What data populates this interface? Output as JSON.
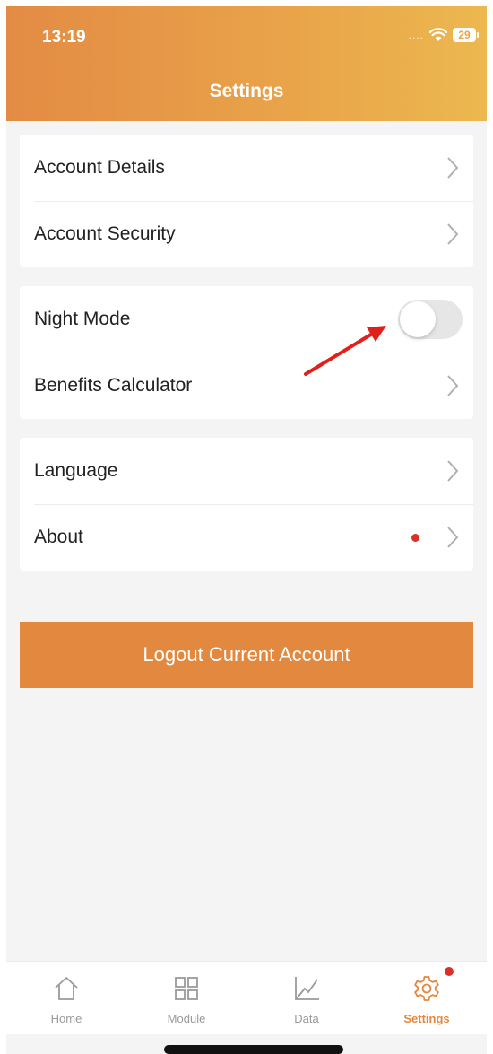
{
  "status_bar": {
    "time": "13:19",
    "signal": "....",
    "battery": "29"
  },
  "header": {
    "title": "Settings"
  },
  "groups": [
    {
      "items": [
        {
          "label": "Account Details"
        },
        {
          "label": "Account Security"
        }
      ]
    },
    {
      "items": [
        {
          "label": "Night Mode",
          "toggle_on": false
        },
        {
          "label": "Benefits Calculator"
        }
      ]
    },
    {
      "items": [
        {
          "label": "Language"
        },
        {
          "label": "About",
          "badge": true
        }
      ]
    }
  ],
  "logout": {
    "label": "Logout Current Account"
  },
  "tabbar": {
    "tabs": [
      {
        "label": "Home",
        "icon": "home-icon"
      },
      {
        "label": "Module",
        "icon": "grid-icon"
      },
      {
        "label": "Data",
        "icon": "chart-line-icon"
      },
      {
        "label": "Settings",
        "icon": "gear-icon",
        "active": true,
        "badge": true
      }
    ]
  },
  "colors": {
    "accent": "#e3893f",
    "header_start": "#e38b44",
    "header_end": "#ecb84f",
    "badge": "#d9302a",
    "annotation_arrow": "#e0201a"
  }
}
